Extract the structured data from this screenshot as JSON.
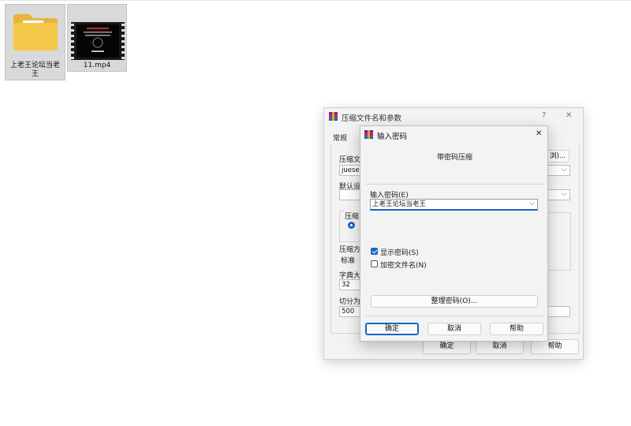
{
  "desktop": {
    "folder_label": "上老王论坛当老王",
    "video_label": "11.mp4"
  },
  "back_dialog": {
    "title": "压缩文件名和参数",
    "help_glyph": "?",
    "close_glyph": "✕",
    "tab_general": "常规",
    "archive_name_label": "压缩文",
    "archive_name_value": "juese",
    "browse_label": "浏)...",
    "default_profile_label": "默认设",
    "format_group_label": "压缩",
    "method_label": "压缩方",
    "method_value": "标准",
    "dict_label": "字典大",
    "dict_value": "32",
    "split_label": "切分为",
    "split_value": "500",
    "ok": "确定",
    "cancel": "取消",
    "help": "帮助"
  },
  "front_dialog": {
    "title": "输入密码",
    "close_glyph": "✕",
    "heading": "带密码压缩",
    "password_label": "输入密码(E)",
    "password_value": "上老王论坛当老王",
    "show_password": "显示密码(S)",
    "show_password_checked": true,
    "encrypt_names": "加密文件名(N)",
    "encrypt_names_checked": false,
    "organize_button": "整理密码(O)...",
    "ok": "确定",
    "cancel": "取消",
    "help": "帮助"
  }
}
